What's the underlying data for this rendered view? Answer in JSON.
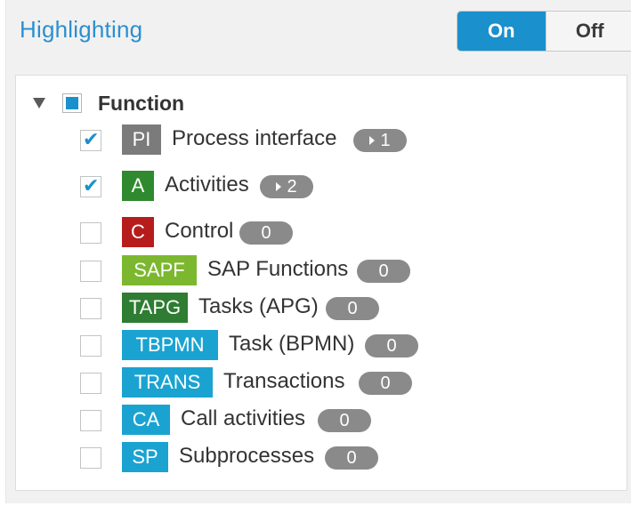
{
  "header": {
    "title": "Highlighting",
    "toggle": {
      "on_label": "On",
      "off_label": "Off",
      "selected": "On"
    }
  },
  "group": {
    "label": "Function",
    "expanded": true,
    "checked": "partial"
  },
  "items": [
    {
      "tag": "PI",
      "tag_color": "#7b7b7b",
      "label": "Process interface",
      "count": "1",
      "checked": true,
      "has_arrow": true
    },
    {
      "tag": "A",
      "tag_color": "#2f8a2f",
      "label": "Activities",
      "count": "2",
      "checked": true,
      "has_arrow": true
    },
    {
      "tag": "C",
      "tag_color": "#b71c1c",
      "label": "Control",
      "count": "0",
      "checked": false,
      "has_arrow": false
    },
    {
      "tag": "SAPF",
      "tag_color": "#7cb82f",
      "label": "SAP Functions",
      "count": "0",
      "checked": false,
      "has_arrow": false
    },
    {
      "tag": "TAPG",
      "tag_color": "#2e7d32",
      "label": "Tasks (APG)",
      "count": "0",
      "checked": false,
      "has_arrow": false
    },
    {
      "tag": "TBPMN",
      "tag_color": "#1aa3d1",
      "label": "Task (BPMN)",
      "count": "0",
      "checked": false,
      "has_arrow": false
    },
    {
      "tag": "TRANS",
      "tag_color": "#1aa3d1",
      "label": "Transactions",
      "count": "0",
      "checked": false,
      "has_arrow": false
    },
    {
      "tag": "CA",
      "tag_color": "#1aa3d1",
      "label": "Call activities",
      "count": "0",
      "checked": false,
      "has_arrow": false
    },
    {
      "tag": "SP",
      "tag_color": "#1aa3d1",
      "label": "Subprocesses",
      "count": "0",
      "checked": false,
      "has_arrow": false
    }
  ]
}
